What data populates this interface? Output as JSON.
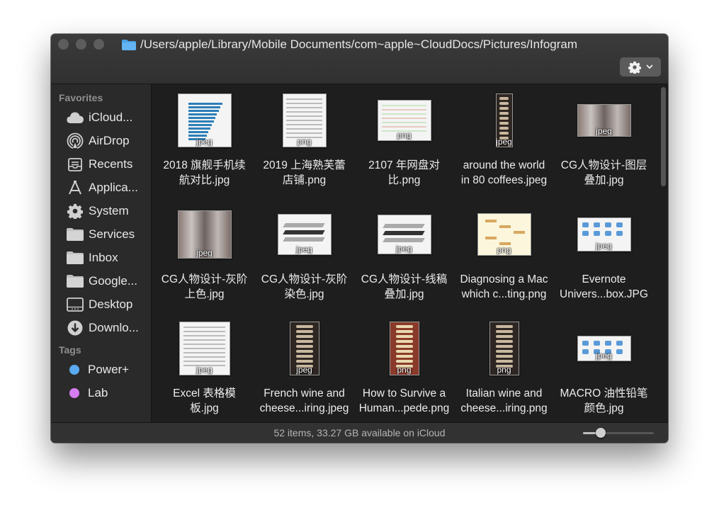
{
  "window": {
    "path": "/Users/apple/Library/Mobile Documents/com~apple~CloudDocs/Pictures/Infogram"
  },
  "sidebar": {
    "favorites_header": "Favorites",
    "favorites": [
      {
        "label": "iCloud...",
        "icon": "cloud-icon"
      },
      {
        "label": "AirDrop",
        "icon": "airdrop-icon"
      },
      {
        "label": "Recents",
        "icon": "recents-icon"
      },
      {
        "label": "Applica...",
        "icon": "applications-icon"
      },
      {
        "label": "System",
        "icon": "gear-icon"
      },
      {
        "label": "Services",
        "icon": "folder-icon"
      },
      {
        "label": "Inbox",
        "icon": "folder-icon"
      },
      {
        "label": "Google...",
        "icon": "folder-icon"
      },
      {
        "label": "Desktop",
        "icon": "desktop-icon"
      },
      {
        "label": "Downlo...",
        "icon": "downloads-icon"
      }
    ],
    "tags_header": "Tags",
    "tags": [
      {
        "label": "Power+",
        "color": "#5aaaf0"
      },
      {
        "label": "Lab",
        "color": "#d67cf0"
      }
    ]
  },
  "files": [
    {
      "line1": "2018 旗舰手机续",
      "line2": "航对比.jpg",
      "ext": "jpeg"
    },
    {
      "line1": "2019 上海熟芙蕾",
      "line2": "店铺.png",
      "ext": "png"
    },
    {
      "line1": "2107 年网盘对",
      "line2": "比.png",
      "ext": "png"
    },
    {
      "line1": "around the world",
      "line2": "in 80 coffees.jpeg",
      "ext": "jpeg"
    },
    {
      "line1": "CG人物设计-图层",
      "line2": "叠加.jpg",
      "ext": "jpeg"
    },
    {
      "line1": "CG人物设计-灰阶",
      "line2": "上色.jpg",
      "ext": "jpeg"
    },
    {
      "line1": "CG人物设计-灰阶",
      "line2": "染色.jpg",
      "ext": "jpeg"
    },
    {
      "line1": "CG人物设计-线稿",
      "line2": "叠加.jpg",
      "ext": "jpeg"
    },
    {
      "line1": "Diagnosing a Mac",
      "line2": "which c...ting.png",
      "ext": "png"
    },
    {
      "line1": "Evernote",
      "line2": "Univers...box.JPG",
      "ext": "jpeg"
    },
    {
      "line1": "Excel 表格模",
      "line2": "板.jpg",
      "ext": "jpeg"
    },
    {
      "line1": "French wine and",
      "line2": "cheese...iring.jpeg",
      "ext": "jpeg"
    },
    {
      "line1": "How to Survive a",
      "line2": "Human...pede.png",
      "ext": "png"
    },
    {
      "line1": "Italian wine and",
      "line2": "cheese...iring.png",
      "ext": "png"
    },
    {
      "line1": "MACRO 油性铅笔",
      "line2": "颜色.jpg",
      "ext": "jpeg"
    }
  ],
  "status": {
    "text": "52 items, 33.27 GB available on iCloud",
    "zoom_level": 0.25
  }
}
